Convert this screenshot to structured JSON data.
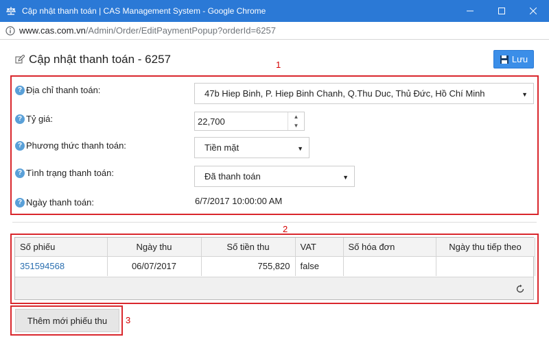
{
  "window": {
    "title": "Cập nhật thanh toán | CAS Management System - Google Chrome",
    "accent": "#2b79d6"
  },
  "address": {
    "domain": "www.cas.com.vn",
    "path": "/Admin/Order/EditPaymentPopup?orderId=6257"
  },
  "page": {
    "title": "Cập nhật thanh toán - 6257",
    "save_label": "Lưu"
  },
  "annotations": [
    "1",
    "2",
    "3"
  ],
  "form": {
    "address_label": "Địa chỉ thanh toán:",
    "address_value": "47b Hiep Binh, P. Hiep Binh Chanh, Q.Thu Duc, Thủ Đức, Hồ Chí Minh",
    "rate_label": "Tỷ giá:",
    "rate_value": "22,700",
    "method_label": "Phương thức thanh toán:",
    "method_value": "Tiền mặt",
    "status_label": "Tình trạng thanh toán:",
    "status_value": "Đã thanh toán",
    "date_label": "Ngày thanh toán:",
    "date_value": "6/7/2017 10:00:00 AM"
  },
  "grid": {
    "columns": [
      "Số phiếu",
      "Ngày thu",
      "Số tiền thu",
      "VAT",
      "Số hóa đơn",
      "Ngày thu tiếp theo"
    ],
    "rows": [
      [
        "351594568",
        "06/07/2017",
        "755,820",
        "false",
        "",
        ""
      ]
    ]
  },
  "add_button_label": "Thêm mới phiếu thu"
}
